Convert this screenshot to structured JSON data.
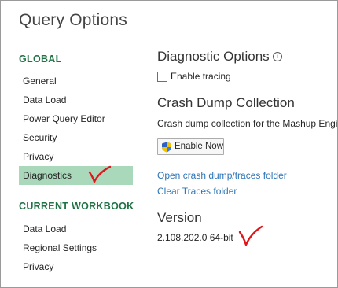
{
  "dialog": {
    "title": "Query Options"
  },
  "sidebar": {
    "global_header": "GLOBAL",
    "global_items": [
      {
        "label": "General"
      },
      {
        "label": "Data Load"
      },
      {
        "label": "Power Query Editor"
      },
      {
        "label": "Security"
      },
      {
        "label": "Privacy"
      },
      {
        "label": "Diagnostics",
        "selected": true
      }
    ],
    "workbook_header": "CURRENT WORKBOOK",
    "workbook_items": [
      {
        "label": "Data Load"
      },
      {
        "label": "Regional Settings"
      },
      {
        "label": "Privacy"
      }
    ]
  },
  "main": {
    "diagnostic_options": {
      "heading": "Diagnostic Options",
      "info_icon": "info-icon",
      "enable_tracing": {
        "label": "Enable tracing",
        "checked": false
      }
    },
    "crash_dump": {
      "heading": "Crash Dump Collection",
      "description": "Crash dump collection for the Mashup Engi",
      "enable_button": {
        "label": "Enable Now",
        "icon": "uac-shield-icon"
      },
      "open_folder_link": "Open crash dump/traces folder",
      "clear_traces_link": "Clear Traces folder"
    },
    "version": {
      "heading": "Version",
      "value": "2.108.202.0 64-bit"
    }
  },
  "colors": {
    "section_header": "#217346",
    "selected_item_bg": "#a9d8bb",
    "link": "#2e75b6",
    "annotation_mark": "#e0161b"
  }
}
